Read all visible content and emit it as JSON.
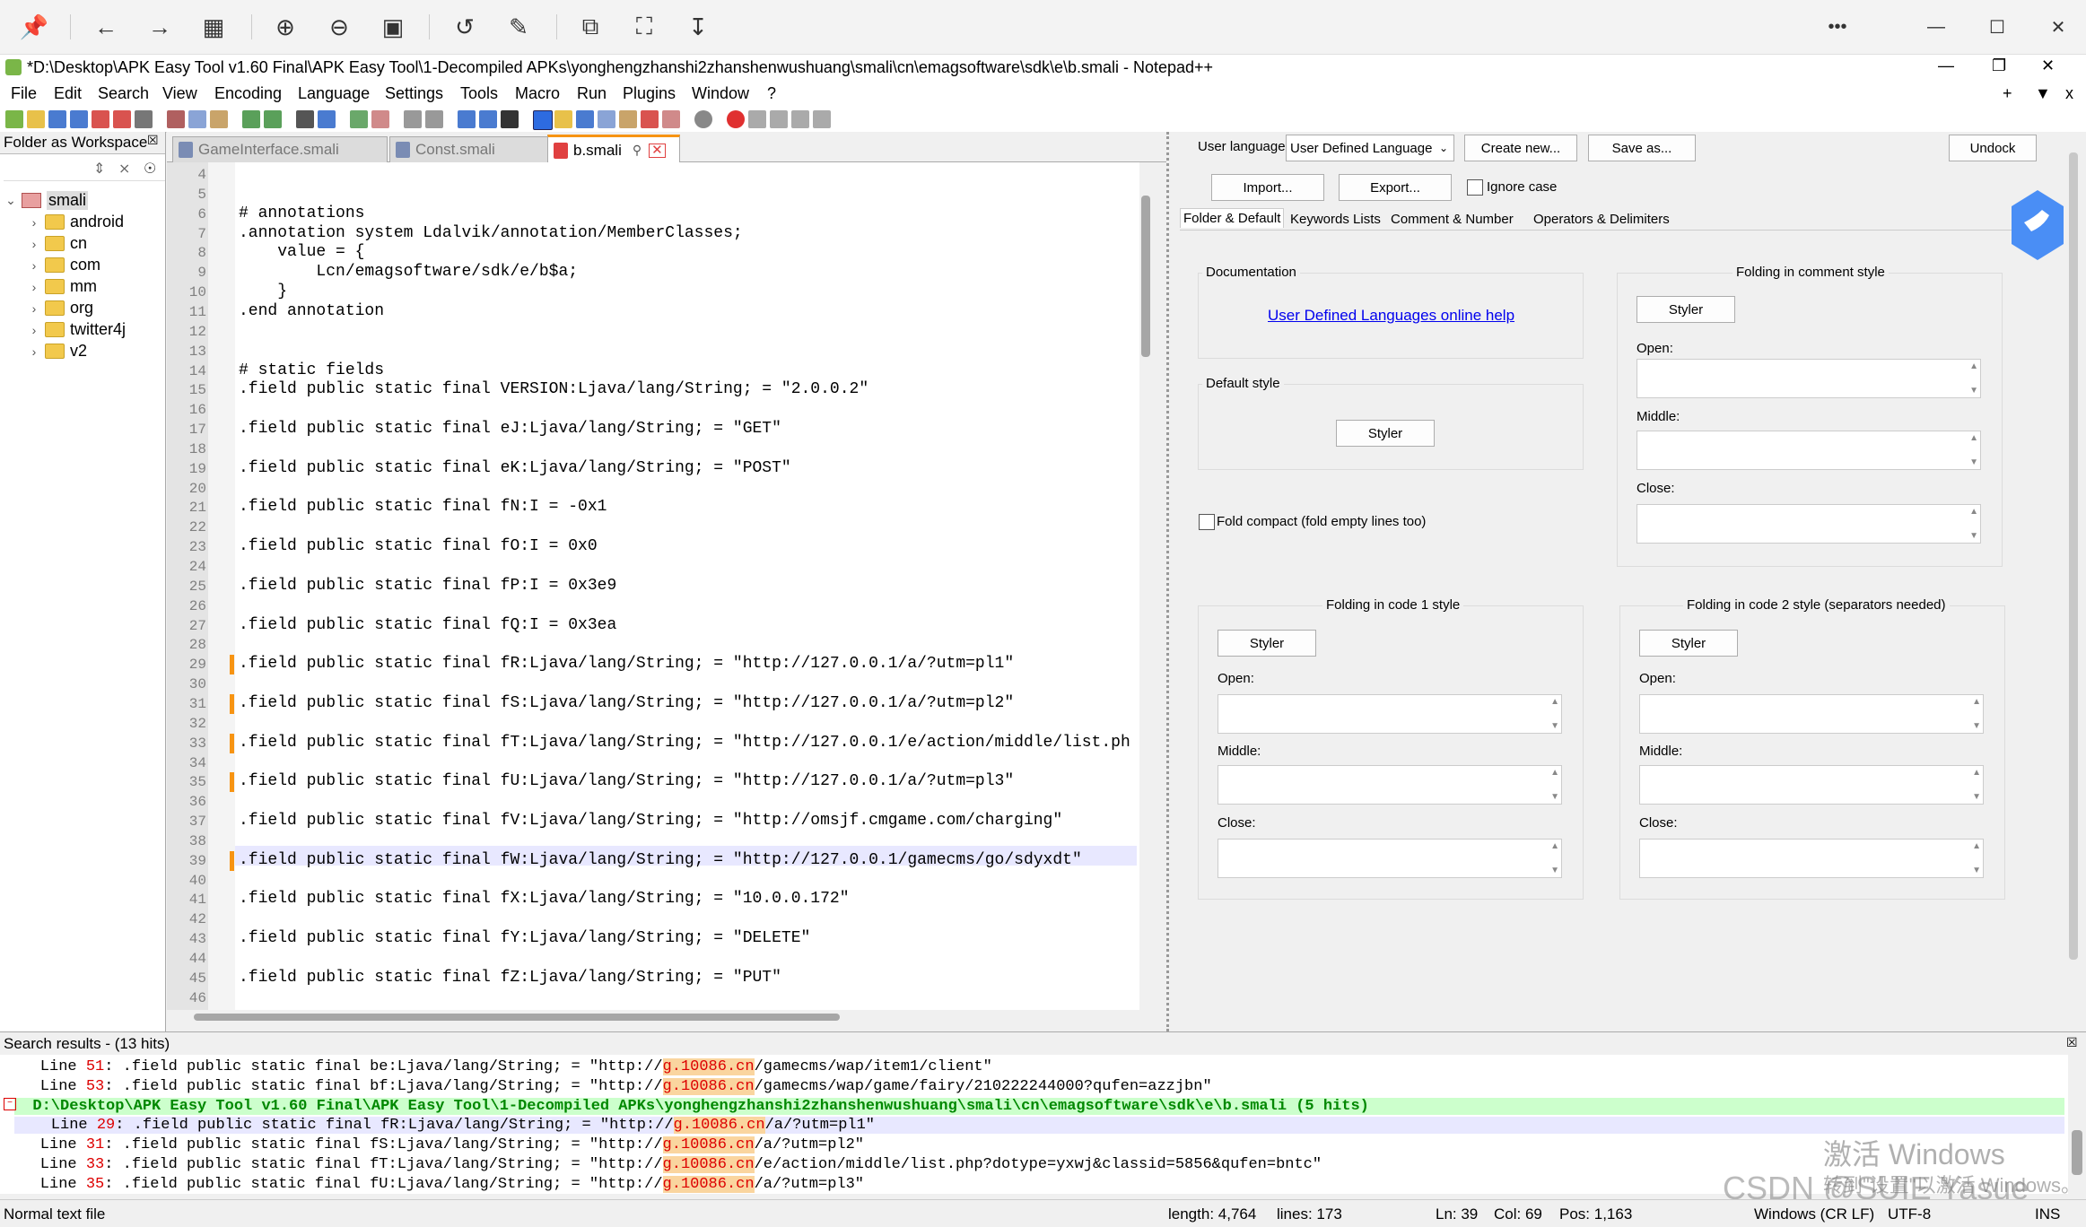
{
  "viewer": {
    "more_label": "•••",
    "min_label": "—",
    "max_label": "☐",
    "close_label": "✕"
  },
  "npp": {
    "title": "*D:\\Desktop\\APK Easy Tool v1.60 Final\\APK Easy Tool\\1-Decompiled APKs\\yonghengzhanshi2zhanshenwushuang\\smali\\cn\\emagsoftware\\sdk\\e\\b.smali - Notepad++",
    "menu": [
      "File",
      "Edit",
      "Search",
      "View",
      "Encoding",
      "Language",
      "Settings",
      "Tools",
      "Macro",
      "Run",
      "Plugins",
      "Window",
      "?"
    ],
    "menu_right": [
      "+",
      "▼",
      "x"
    ]
  },
  "workspace": {
    "title": "Folder as Workspace",
    "root": "smali",
    "folders": [
      "android",
      "cn",
      "com",
      "mm",
      "org",
      "twitter4j",
      "v2"
    ]
  },
  "tabs": [
    {
      "label": "GameInterface.smali",
      "active": false
    },
    {
      "label": "Const.smali",
      "active": false
    },
    {
      "label": "b.smali",
      "active": true
    }
  ],
  "editor": {
    "lines": [
      {
        "n": "4",
        "t": "",
        "chg": false
      },
      {
        "n": "5",
        "t": "",
        "chg": false
      },
      {
        "n": "6",
        "t": "# annotations",
        "chg": false
      },
      {
        "n": "7",
        "t": ".annotation system Ldalvik/annotation/MemberClasses;",
        "chg": false
      },
      {
        "n": "8",
        "t": "    value = {",
        "chg": false
      },
      {
        "n": "9",
        "t": "        Lcn/emagsoftware/sdk/e/b$a;",
        "chg": false
      },
      {
        "n": "10",
        "t": "    }",
        "chg": false
      },
      {
        "n": "11",
        "t": ".end annotation",
        "chg": false
      },
      {
        "n": "12",
        "t": "",
        "chg": false
      },
      {
        "n": "13",
        "t": "",
        "chg": false
      },
      {
        "n": "14",
        "t": "# static fields",
        "chg": false
      },
      {
        "n": "15",
        "t": ".field public static final VERSION:Ljava/lang/String; = \"2.0.0.2\"",
        "chg": false
      },
      {
        "n": "16",
        "t": "",
        "chg": false
      },
      {
        "n": "17",
        "t": ".field public static final eJ:Ljava/lang/String; = \"GET\"",
        "chg": false
      },
      {
        "n": "18",
        "t": "",
        "chg": false
      },
      {
        "n": "19",
        "t": ".field public static final eK:Ljava/lang/String; = \"POST\"",
        "chg": false
      },
      {
        "n": "20",
        "t": "",
        "chg": false
      },
      {
        "n": "21",
        "t": ".field public static final fN:I = -0x1",
        "chg": false
      },
      {
        "n": "22",
        "t": "",
        "chg": false
      },
      {
        "n": "23",
        "t": ".field public static final fO:I = 0x0",
        "chg": false
      },
      {
        "n": "24",
        "t": "",
        "chg": false
      },
      {
        "n": "25",
        "t": ".field public static final fP:I = 0x3e9",
        "chg": false
      },
      {
        "n": "26",
        "t": "",
        "chg": false
      },
      {
        "n": "27",
        "t": ".field public static final fQ:I = 0x3ea",
        "chg": false
      },
      {
        "n": "28",
        "t": "",
        "chg": false
      },
      {
        "n": "29",
        "t": ".field public static final fR:Ljava/lang/String; = \"http://127.0.0.1/a/?utm=pl1\"",
        "chg": true
      },
      {
        "n": "30",
        "t": "",
        "chg": false
      },
      {
        "n": "31",
        "t": ".field public static final fS:Ljava/lang/String; = \"http://127.0.0.1/a/?utm=pl2\"",
        "chg": true
      },
      {
        "n": "32",
        "t": "",
        "chg": false
      },
      {
        "n": "33",
        "t": ".field public static final fT:Ljava/lang/String; = \"http://127.0.0.1/e/action/middle/list.ph",
        "chg": true
      },
      {
        "n": "34",
        "t": "",
        "chg": false
      },
      {
        "n": "35",
        "t": ".field public static final fU:Ljava/lang/String; = \"http://127.0.0.1/a/?utm=pl3\"",
        "chg": true
      },
      {
        "n": "36",
        "t": "",
        "chg": false
      },
      {
        "n": "37",
        "t": ".field public static final fV:Ljava/lang/String; = \"http://omsjf.cmgame.com/charging\"",
        "chg": false
      },
      {
        "n": "38",
        "t": "",
        "chg": false
      },
      {
        "n": "39",
        "t": ".field public static final fW:Ljava/lang/String; = \"http://127.0.0.1/gamecms/go/sdyxdt\"",
        "chg": true
      },
      {
        "n": "40",
        "t": "",
        "chg": false
      },
      {
        "n": "41",
        "t": ".field public static final fX:Ljava/lang/String; = \"10.0.0.172\"",
        "chg": false
      },
      {
        "n": "42",
        "t": "",
        "chg": false
      },
      {
        "n": "43",
        "t": ".field public static final fY:Ljava/lang/String; = \"DELETE\"",
        "chg": false
      },
      {
        "n": "44",
        "t": "",
        "chg": false
      },
      {
        "n": "45",
        "t": ".field public static final fZ:Ljava/lang/String; = \"PUT\"",
        "chg": false
      },
      {
        "n": "46",
        "t": "",
        "chg": false
      }
    ]
  },
  "udl": {
    "user_language_label": "User language:",
    "user_language_value": "User Defined Language",
    "create_new": "Create new...",
    "save_as": "Save as...",
    "undock": "Undock",
    "import": "Import...",
    "export": "Export...",
    "ignore_case": "Ignore case",
    "tabs": [
      "Folder & Default",
      "Keywords Lists",
      "Comment & Number",
      "Operators & Delimiters"
    ],
    "documentation": "Documentation",
    "doc_link": "User Defined Languages online help",
    "default_style": "Default style",
    "styler": "Styler",
    "fold_compact": "Fold compact (fold empty lines too)",
    "folding_comment": "Folding in comment style",
    "folding_code1": "Folding in code 1 style",
    "folding_code2": "Folding in code 2 style (separators needed)",
    "open": "Open:",
    "middle": "Middle:",
    "close": "Close:"
  },
  "search": {
    "header": "Search results - (13 hits)",
    "lines": [
      {
        "kind": "hit",
        "pre": "    Line ",
        "num": "51",
        "mid": ": .field public static final be:Ljava/lang/String; = \"http://",
        "hl": "g.10086.cn",
        "post": "/gamecms/wap/item1/client\""
      },
      {
        "kind": "hit",
        "pre": "    Line ",
        "num": "53",
        "mid": ": .field public static final bf:Ljava/lang/String; = \"http://",
        "hl": "g.10086.cn",
        "post": "/gamecms/wap/game/fairy/210222244000?qufen=azzjbn\""
      },
      {
        "kind": "file",
        "text": "  D:\\Desktop\\APK Easy Tool v1.60 Final\\APK Easy Tool\\1-Decompiled APKs\\yonghengzhanshi2zhanshenwushuang\\smali\\cn\\emagsoftware\\sdk\\e\\b.smali (5 hits)"
      },
      {
        "kind": "hit",
        "pre": "    Line ",
        "num": "29",
        "mid": ": .field public static final fR:Ljava/lang/String; = \"http://",
        "hl": "g.10086.cn",
        "post": "/a/?utm=pl1\""
      },
      {
        "kind": "hit",
        "pre": "    Line ",
        "num": "31",
        "mid": ": .field public static final fS:Ljava/lang/String; = \"http://",
        "hl": "g.10086.cn",
        "post": "/a/?utm=pl2\""
      },
      {
        "kind": "hit",
        "pre": "    Line ",
        "num": "33",
        "mid": ": .field public static final fT:Ljava/lang/String; = \"http://",
        "hl": "g.10086.cn",
        "post": "/e/action/middle/list.php?dotype=yxwj&classid=5856&qufen=bntc\""
      },
      {
        "kind": "hit",
        "pre": "    Line ",
        "num": "35",
        "mid": ": .field public static final fU:Ljava/lang/String; = \"http://",
        "hl": "g.10086.cn",
        "post": "/a/?utm=pl3\""
      }
    ]
  },
  "status": {
    "type": "Normal text file",
    "length": "length: 4,764",
    "lines": "lines: 173",
    "ln": "Ln: 39",
    "col": "Col: 69",
    "pos": "Pos: 1,163",
    "eol": "Windows (CR LF)",
    "enc": "UTF-8",
    "ins": "INS"
  },
  "watermark": {
    "activate": "激活 Windows",
    "activate_sub": "转到\"设置\"以激活 Windows。",
    "csdn": "CSDN @SUIE Yasue"
  },
  "colors": {
    "accent": "#f79413",
    "search_file_bg": "#ccffcc",
    "hit_bg": "#fad59f",
    "link": "#0000ee"
  }
}
